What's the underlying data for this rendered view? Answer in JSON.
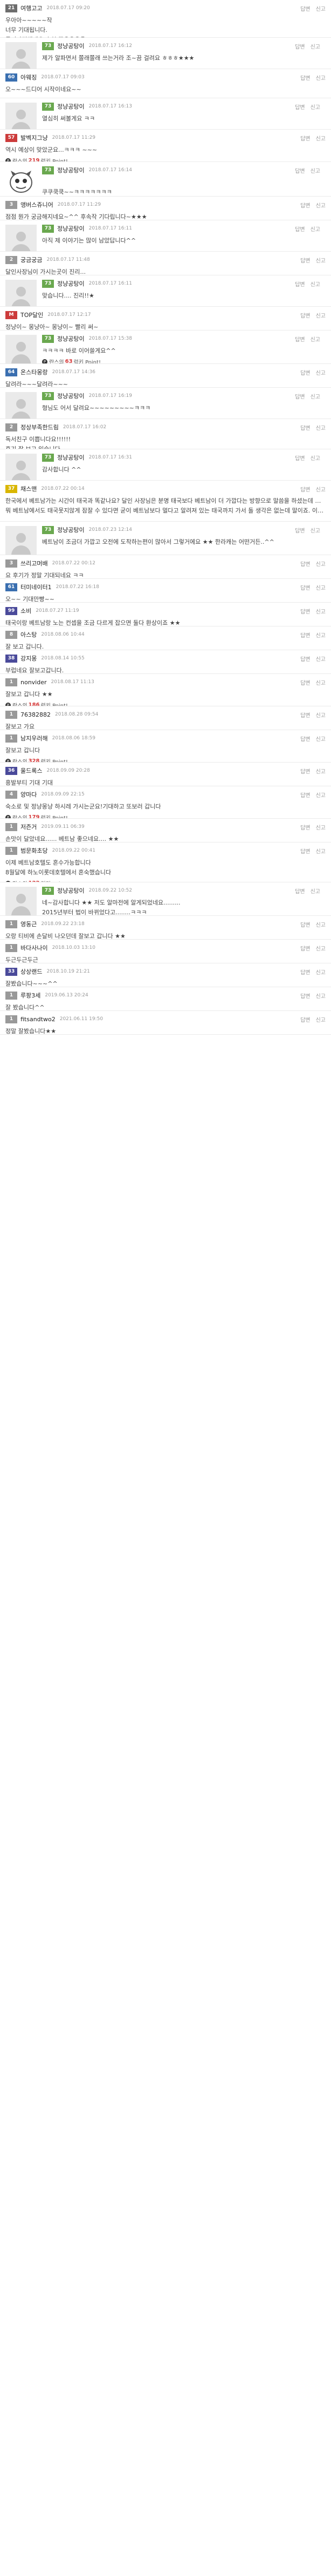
{
  "ui": {
    "reply_label": "답변",
    "report_label": "신고",
    "point_suffix": "럭키 Point!",
    "point_prefix": "란스의"
  },
  "comments": [
    {
      "lvl": "21",
      "lc": "#6d6d6d",
      "nick": "여행고고",
      "date": "2018.07.17 09:20",
      "lines": [
        "우아아~~~~~작",
        "너무 기대됩니다.",
        "뭇기다리겠네요 추천 꾸우우우욱"
      ],
      "reply": false,
      "h": 70
    },
    {
      "lvl": "73",
      "lc": "#6aa84f",
      "nick": "정냥공탕이",
      "date": "2018.07.17 16:12",
      "lines": [
        "제가 알파면서 쫄래쫄래 쓰는거라 조~끔 걸려요 ㅎㅎㅎ★★★"
      ],
      "reply": true,
      "av": "ph",
      "h": 58
    },
    {
      "lvl": "60",
      "lc": "#3a6fb0",
      "nick": "아웨징",
      "date": "2018.07.17 09:03",
      "lines": [
        "오~~~드디어 시작이네요~~"
      ],
      "reply": false,
      "point": "5",
      "h": 54
    },
    {
      "lvl": "73",
      "lc": "#6aa84f",
      "nick": "정냥공탕이",
      "date": "2018.07.17 16:13",
      "lines": [
        "열심히 써볼게요 ㅋㅋ"
      ],
      "reply": true,
      "av": "ph",
      "h": 58
    },
    {
      "lvl": "57",
      "lc": "#cc3b3b",
      "nick": "발벡지그냥",
      "date": "2018.07.17 11:29",
      "lines": [
        "역시 예상이 맞았군요...ㅋㅋㅋ ~~~"
      ],
      "reply": false,
      "point": "219",
      "h": 60
    },
    {
      "lvl": "73",
      "lc": "#6aa84f",
      "nick": "정냥공탕이",
      "date": "2018.07.17 16:14",
      "lines": [
        "",
        "쿠쿠쿡쿡~~ㅋㅋㅋㅋㅋㅋㅋ"
      ],
      "reply": true,
      "av": "mascot",
      "h": 64
    },
    {
      "lvl": "3",
      "lc": "#999999",
      "nick": "앵버스쥬니어",
      "date": "2018.07.17 11:29",
      "lines": [
        "점점 뭔가 궁금해지네요~^^ 후속작 기다립니다~★★★"
      ],
      "reply": false,
      "h": 44
    },
    {
      "lvl": "73",
      "lc": "#6aa84f",
      "nick": "정냥공탕이",
      "date": "2018.07.17 16:11",
      "lines": [
        "아직 제 이야기는 많이 남았답니다^^"
      ],
      "reply": true,
      "av": "ph",
      "h": 58
    },
    {
      "lvl": "2",
      "lc": "#999999",
      "nick": "궁금궁금",
      "date": "2018.07.17 11:48",
      "lines": [
        "달인사장님이 가시는곳이 진리..."
      ],
      "reply": false,
      "h": 44
    },
    {
      "lvl": "73",
      "lc": "#6aa84f",
      "nick": "정냥공탕이",
      "date": "2018.07.17 16:11",
      "lines": [
        "맞습니다.... 진리!!★"
      ],
      "reply": true,
      "av": "ph",
      "h": 58
    },
    {
      "lvl": "M",
      "lc": "#cc3b3b",
      "nick": "TOP달인",
      "date": "2018.07.17 12:17",
      "lines": [
        "정냥이~ 몽냥아~ 몽냥이~ 빨리 써~"
      ],
      "reply": false,
      "h": 44
    },
    {
      "lvl": "73",
      "lc": "#6aa84f",
      "nick": "정냥공탕이",
      "date": "2018.07.17 15:38",
      "lines": [
        "ㅋㅋㅋㅋ 바로 이어쓸게요^^"
      ],
      "reply": true,
      "av": "ph",
      "point": "63",
      "h": 62
    },
    {
      "lvl": "64",
      "lc": "#3a6fb0",
      "nick": "온스타몽랑",
      "date": "2018.07.17 14:36",
      "lines": [
        "달려라~~~달려라~~~"
      ],
      "reply": false,
      "h": 44
    },
    {
      "lvl": "73",
      "lc": "#6aa84f",
      "nick": "정냥공탕이",
      "date": "2018.07.17 16:19",
      "lines": [
        "형님도 어서 달려요~~~~~~~~~ㅋㅋㅋ"
      ],
      "reply": true,
      "av": "ph",
      "h": 58
    },
    {
      "lvl": "2",
      "lc": "#999999",
      "nick": "정상부족한드림",
      "date": "2018.07.17 16:02",
      "lines": [
        "독서친구 이쁩니다요!!!!!!",
        "후기 잘 보고 있습니다~"
      ],
      "reply": false,
      "h": 56
    },
    {
      "lvl": "73",
      "lc": "#6aa84f",
      "nick": "정냥공탕이",
      "date": "2018.07.17 16:31",
      "lines": [
        "감사합니다 ^^"
      ],
      "reply": true,
      "av": "ph",
      "h": 58
    },
    {
      "lvl": "37",
      "lc": "#d9b600",
      "nick": "채스맨",
      "date": "2018.07.22 00:14",
      "lines": [
        "한국에서 베트남가는 시간이 태국과 똑같나요? 달인 사장님은 분명 태국보다 베트남이 더 가깝다는 방향으로 말씀을 하셨는데 말이죠.",
        "뭐 베트남에서도 태국못지않게 잠잘 수 있다면 굳이 베트남보다 멀다고 알려져 있는 태국까지 가서 돌 생각은 없는데 말이죠. 이거 고민이네요?★"
      ],
      "reply": false,
      "h": 76
    },
    {
      "lvl": "73",
      "lc": "#6aa84f",
      "nick": "정냥공탕이",
      "date": "2018.07.23 12:14",
      "lines": [
        "베트남이 조금더 가깝고 오전에 도착하는편이 많아서 그렇거에요 ★★ 한라캐는 어떤거든..^^"
      ],
      "reply": true,
      "av": "ph",
      "h": 62
    },
    {
      "lvl": "3",
      "lc": "#999999",
      "nick": "쓰리고머배",
      "date": "2018.07.22 00:12",
      "lines": [
        "요 후기가 정말 기대되네요 ㅋㅋ"
      ],
      "reply": false,
      "h": 44
    },
    {
      "lvl": "61",
      "lc": "#3a6fb0",
      "nick": "터미네이터1",
      "date": "2018.07.22 16:18",
      "lines": [
        "오~~ 기대만빵~~"
      ],
      "reply": false,
      "h": 44
    },
    {
      "lvl": "99",
      "lc": "#4a4a9a",
      "nick": "소비",
      "date": "2018.07.27 11:19",
      "lines": [
        "태국이랑 베트남랑 노는 컨셉을 조금 다르게 잡으면 둘다 환상이죠 ★★"
      ],
      "reply": false,
      "h": 44
    },
    {
      "lvl": "8",
      "lc": "#999999",
      "nick": "아스탕",
      "date": "2018.08.06 10:44",
      "lines": [
        "잘 보고 갑니다."
      ],
      "reply": false,
      "h": 44
    },
    {
      "lvl": "38",
      "lc": "#4a4a9a",
      "nick": "강지몽",
      "date": "2018.08.14 10:55",
      "lines": [
        "부럽네요 잘보고갑니다."
      ],
      "reply": false,
      "h": 44
    },
    {
      "lvl": "1",
      "lc": "#999999",
      "nick": "nonvider",
      "date": "2018.08.17 11:13",
      "lines": [
        "잘보고 갑니다 ★★"
      ],
      "reply": false,
      "point": "186",
      "h": 60
    },
    {
      "lvl": "1",
      "lc": "#999999",
      "nick": "76382882",
      "date": "2018.08.28 09:54",
      "lines": [
        "잘보고 가요"
      ],
      "reply": false,
      "h": 44
    },
    {
      "lvl": "1",
      "lc": "#999999",
      "nick": "남지우러해",
      "date": "2018.08.06 18:59",
      "lines": [
        "잘보고 갑니다"
      ],
      "reply": false,
      "point": "328",
      "h": 60
    },
    {
      "lvl": "36",
      "lc": "#4a4a9a",
      "nick": "울드록스",
      "date": "2018.09.09 20:28",
      "lines": [
        "흥발부티 기대 기대"
      ],
      "reply": false,
      "h": 44
    },
    {
      "lvl": "4",
      "lc": "#999999",
      "nick": "양마다",
      "date": "2018.09.09 22:15",
      "lines": [
        "숙소로 및 정냥몽냥 하시레 가시는군요!기대하고 또보러 갑니다"
      ],
      "reply": false,
      "point": "179",
      "h": 60
    },
    {
      "lvl": "1",
      "lc": "#999999",
      "nick": "저즌거",
      "date": "2019.09.11 06:39",
      "lines": [
        "손맛이 달았네요...... 베트남 좋으네요.... ★★"
      ],
      "reply": false,
      "h": 44
    },
    {
      "lvl": "1",
      "lc": "#999999",
      "nick": "범문화초당",
      "date": "2018.09.22 00:41",
      "lines": [
        "이제 베트남호텔도 혼수가능합니다",
        "8월달에 하노이롯데호텔에서 혼숙했습니다"
      ],
      "reply": false,
      "point": "122",
      "h": 74
    },
    {
      "lvl": "73",
      "lc": "#6aa84f",
      "nick": "정냥공탕이",
      "date": "2018.09.22 10:52",
      "lines": [
        "네~감사합니다 ★★ 저도 알마전에 알게되었네요.........",
        "2015년부터 법이 바뀌었다고........ㅋㅋㅋ"
      ],
      "reply": true,
      "av": "ph",
      "h": 62
    },
    {
      "lvl": "1",
      "lc": "#999999",
      "nick": "영동근",
      "date": "2018.09.22 23:18",
      "lines": [
        "오랑 티비에 손달비 나오던데 잘보고 갑니다 ★★"
      ],
      "reply": false,
      "h": 44
    },
    {
      "lvl": "1",
      "lc": "#999999",
      "nick": "바다사나이",
      "date": "2018.10.03 13:10",
      "lines": [
        "두근두근두근"
      ],
      "reply": false,
      "h": 44
    },
    {
      "lvl": "33",
      "lc": "#4a4a9a",
      "nick": "상상랜드",
      "date": "2018.10.19 21:21",
      "lines": [
        "잘봤습니다~~~^^"
      ],
      "reply": false,
      "h": 44
    },
    {
      "lvl": "1",
      "lc": "#999999",
      "nick": "루팡3세",
      "date": "2019.06.13 20:24",
      "lines": [
        "잘 봤습니다^^"
      ],
      "reply": false,
      "h": 44
    },
    {
      "lvl": "1",
      "lc": "#999999",
      "nick": "fitsandtwo2",
      "date": "2021.06.11 19:50",
      "lines": [
        "정말 잘봤습니다★★"
      ],
      "reply": false,
      "h": 44
    }
  ]
}
